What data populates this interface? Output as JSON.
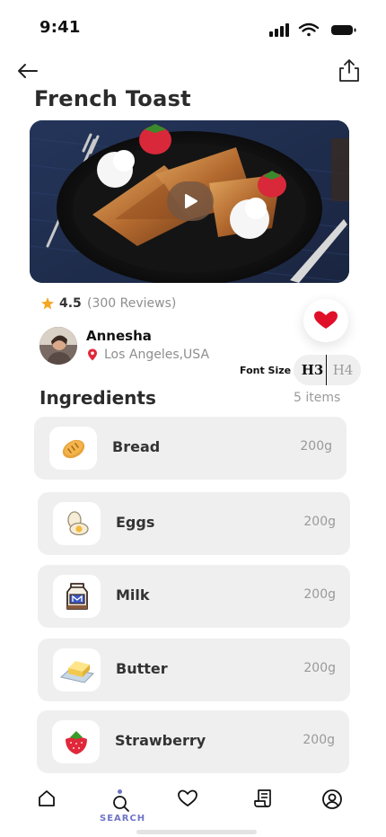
{
  "status_bar": {
    "time": "9:41"
  },
  "recipe": {
    "title": "French Toast",
    "rating": "4.5",
    "reviews": "(300 Reviews)",
    "author": {
      "name": "Annesha",
      "location": "Los Angeles,USA"
    }
  },
  "font_size": {
    "label": "Font Size",
    "options": [
      "H3",
      "H4"
    ],
    "selected": "H3"
  },
  "ingredients": {
    "title": "Ingredients",
    "count": "5 items",
    "items": [
      {
        "name": "Bread",
        "qty": "200g",
        "icon": "bread-icon"
      },
      {
        "name": "Eggs",
        "qty": "200g",
        "icon": "egg-icon"
      },
      {
        "name": "Milk",
        "qty": "200g",
        "icon": "milk-carton-icon"
      },
      {
        "name": "Butter",
        "qty": "200g",
        "icon": "butter-icon"
      },
      {
        "name": "Strawberry",
        "qty": "200g",
        "icon": "strawberry-icon"
      }
    ]
  },
  "nav": {
    "items": [
      "home-icon",
      "search-icon",
      "heart-icon",
      "receipt-icon",
      "profile-icon"
    ],
    "active": "SEARCH"
  },
  "colors": {
    "accent": "#6f74c8",
    "favorite": "#e0102a",
    "star": "#f5a623",
    "card": "#efefef"
  }
}
